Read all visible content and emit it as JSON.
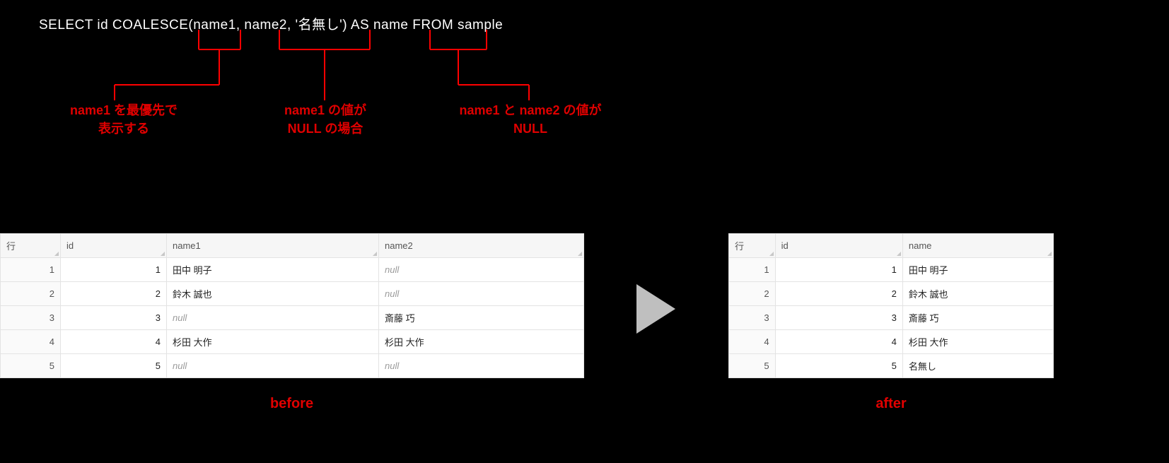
{
  "sql": "SELECT id COALESCE(name1, name2, '名無し') AS name FROM sample",
  "annotations": {
    "a1": {
      "l1": "name1 を最優先で",
      "l2": "表示する"
    },
    "a2": {
      "l1": "name1 の値が",
      "l2": "NULL の場合"
    },
    "a3": {
      "l1": "name1 と name2 の値が",
      "l2": "NULL"
    }
  },
  "before": {
    "headers": {
      "row": "行",
      "id": "id",
      "name1": "name1",
      "name2": "name2"
    },
    "rows": [
      {
        "row": "1",
        "id": "1",
        "name1": "田中 明子",
        "name2": null
      },
      {
        "row": "2",
        "id": "2",
        "name1": "鈴木 誠也",
        "name2": null
      },
      {
        "row": "3",
        "id": "3",
        "name1": null,
        "name2": "斎藤 巧"
      },
      {
        "row": "4",
        "id": "4",
        "name1": "杉田 大作",
        "name2": "杉田 大作"
      },
      {
        "row": "5",
        "id": "5",
        "name1": null,
        "name2": null
      }
    ],
    "caption": "before"
  },
  "after": {
    "headers": {
      "row": "行",
      "id": "id",
      "name": "name"
    },
    "rows": [
      {
        "row": "1",
        "id": "1",
        "name": "田中 明子"
      },
      {
        "row": "2",
        "id": "2",
        "name": "鈴木 誠也"
      },
      {
        "row": "3",
        "id": "3",
        "name": "斎藤 巧"
      },
      {
        "row": "4",
        "id": "4",
        "name": "杉田 大作"
      },
      {
        "row": "5",
        "id": "5",
        "name": "名無し"
      }
    ],
    "caption": "after"
  },
  "nullLabel": "null"
}
